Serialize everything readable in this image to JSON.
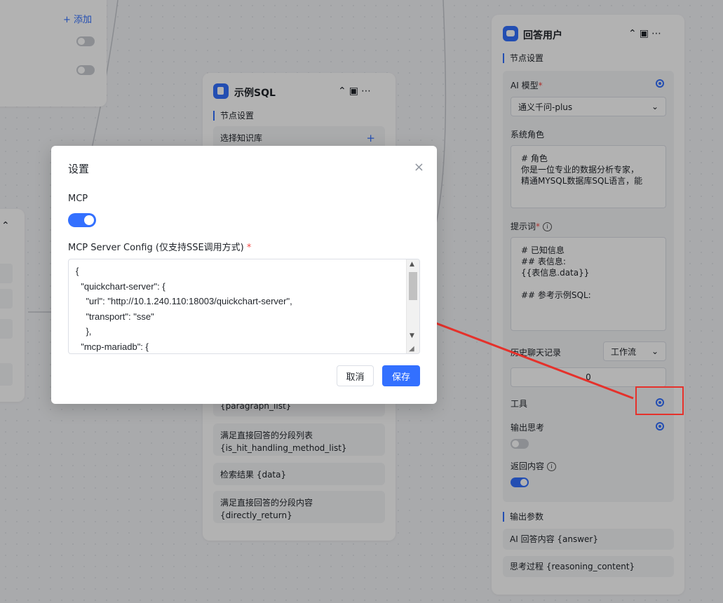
{
  "canvas": {
    "left_node": {
      "add_label": "+ 添加"
    },
    "middle_node": {
      "title": "示例SQL",
      "section": "节点设置",
      "kb_label": "选择知识库",
      "fields": [
        "{paragraph_list}",
        "满足直接回答的分段列表 {is_hit_handling_method_list}",
        "检索结果 {data}",
        "满足直接回答的分段内容 {directly_return}"
      ]
    },
    "right_node": {
      "title": "回答用户",
      "section_settings": "节点设置",
      "ai_model_label": "AI 模型",
      "ai_model_value": "通义千问-plus",
      "system_role_label": "系统角色",
      "system_role_text": "# 角色\n你是一位专业的数据分析专家，\n精通MYSQL数据库SQL语言，能",
      "prompt_label": "提示词",
      "prompt_text": "# 已知信息\n## 表信息:\n{{表信息.data}}\n\n## 参考示例SQL:",
      "history_label": "历史聊天记录",
      "history_select": "工作流",
      "history_value": "0",
      "tools_label": "工具",
      "output_thinking_label": "输出思考",
      "return_content_label": "返回内容",
      "output_params_label": "输出参数",
      "output_params": [
        "AI 回答内容 {answer}",
        "思考过程 {reasoning_content}"
      ]
    }
  },
  "dialog": {
    "title": "设置",
    "close_symbol": "×",
    "mcp_label": "MCP",
    "mcp_enabled": true,
    "config_label": "MCP Server Config (仅支持SSE调用方式)",
    "required_mark": "*",
    "config_text": "{\n  \"quickchart-server\": {\n    \"url\": \"http://10.1.240.110:18003/quickchart-server\",\n    \"transport\": \"sse\"\n    },\n  \"mcp-mariadb\": {",
    "cancel_label": "取消",
    "save_label": "保存"
  },
  "colors": {
    "accent": "#3370ff",
    "annotation": "#e5312b"
  }
}
